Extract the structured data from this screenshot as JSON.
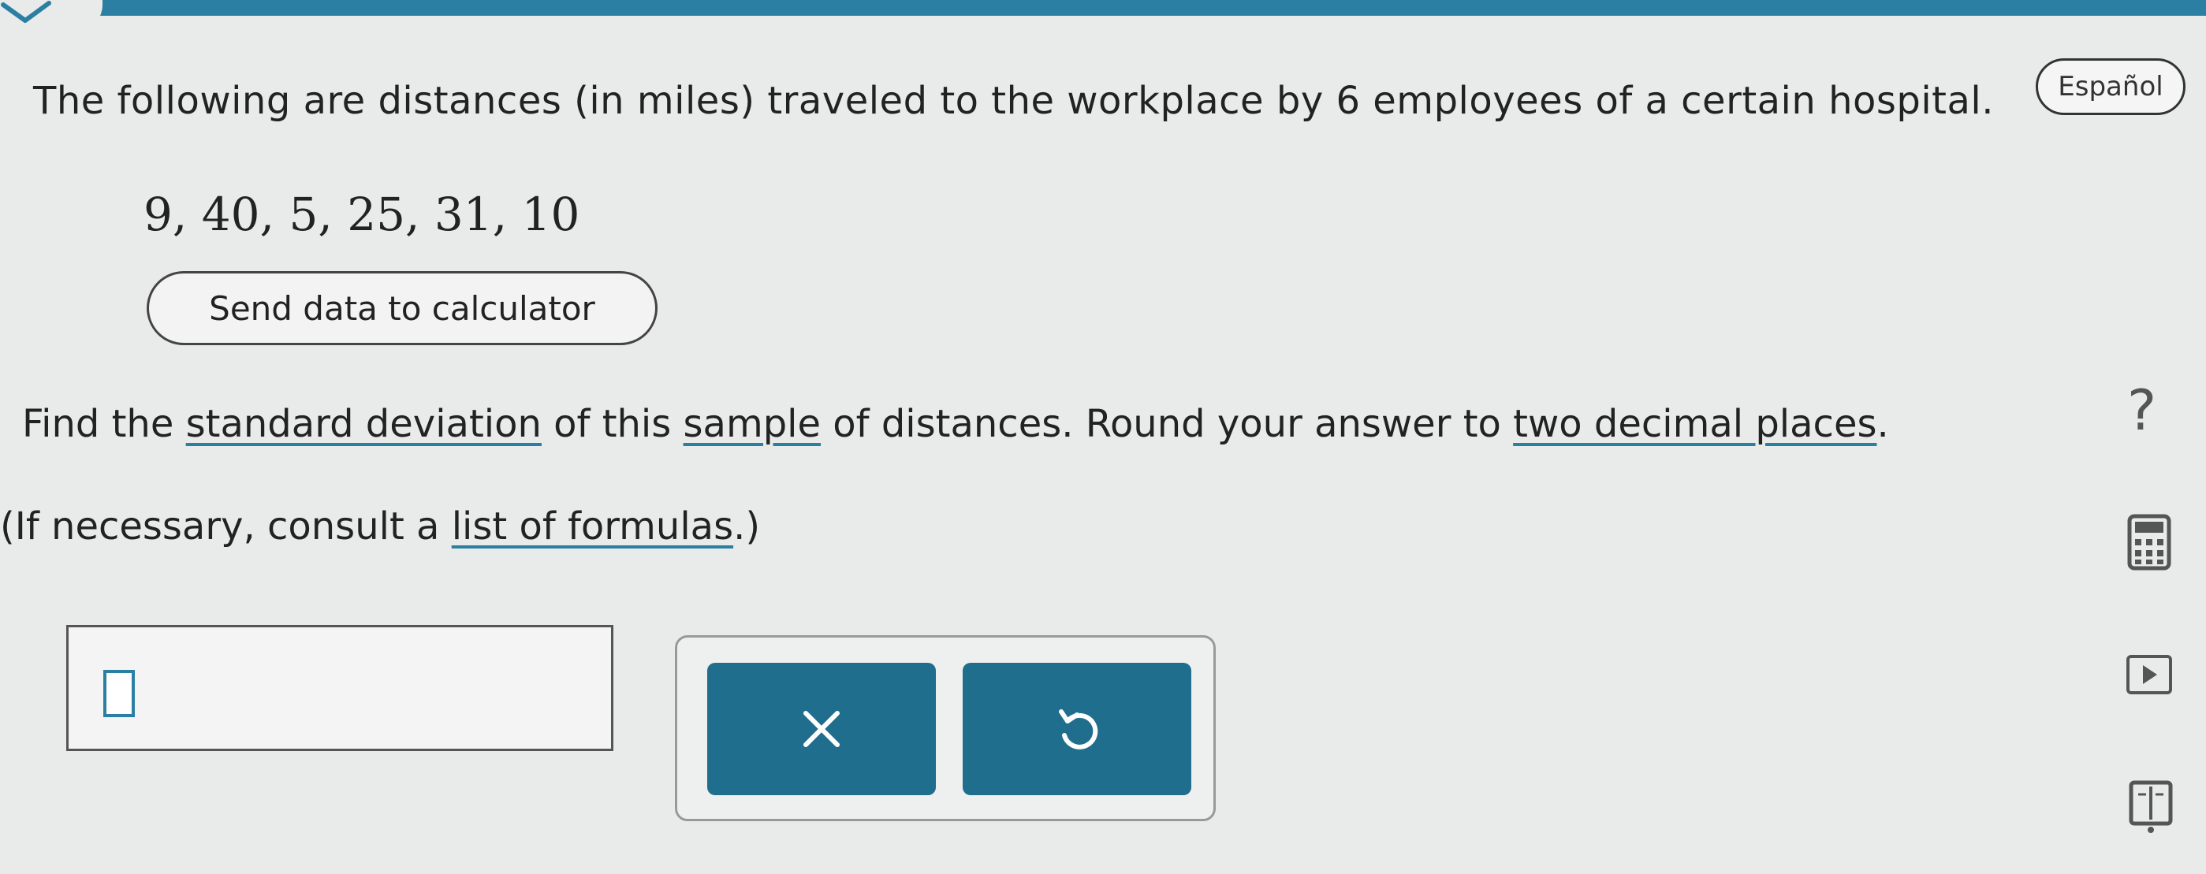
{
  "header": {
    "language_button": "Español"
  },
  "problem": {
    "statement": "The following are distances (in miles) traveled to the workplace by 6 employees of a certain hospital.",
    "dataset": "9, 40, 5, 25, 31, 10",
    "send_button": "Send data to calculator"
  },
  "instruction": {
    "part1": "Find the ",
    "link_sd": "standard deviation",
    "part2": " of this ",
    "link_sample": "sample",
    "part3": " of distances. Round your answer to ",
    "link_decimals": "two decimal places",
    "part4": ".",
    "formulas_prefix": "(If necessary, consult a ",
    "link_formulas": "list of formulas",
    "formulas_suffix": ".)"
  },
  "answer": {
    "value": ""
  },
  "side_tools": {
    "help": "?"
  },
  "icons": [
    "chevron-down-icon",
    "help-icon",
    "calculator-icon",
    "play-icon",
    "book-icon",
    "clear-icon",
    "undo-icon"
  ],
  "colors": {
    "accent": "#2a7fa3",
    "button": "#1f6e8d"
  }
}
